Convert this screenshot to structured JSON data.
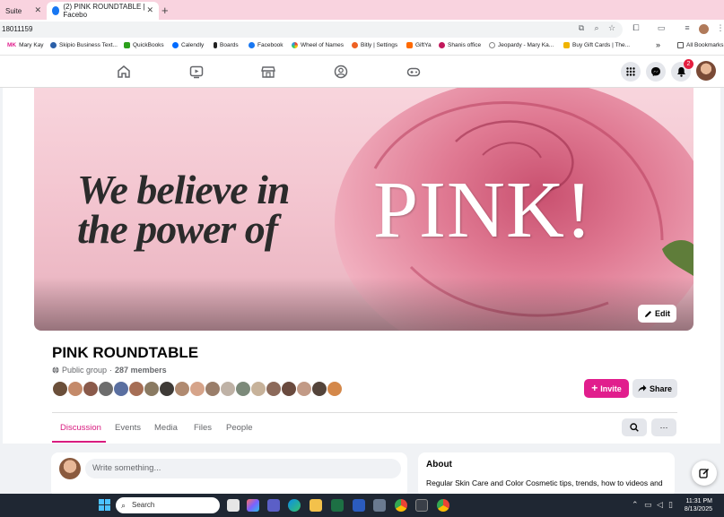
{
  "browser": {
    "tabs": [
      {
        "label": "Suite",
        "active": false
      },
      {
        "label": "(2) PINK ROUNDTABLE | Facebo",
        "active": true
      }
    ],
    "new_tab_glyph": "+",
    "close_glyph": "✕",
    "address": "18011159"
  },
  "bookmarks": [
    {
      "label": "Mary Kay",
      "color": "#e11e8d"
    },
    {
      "label": "Skipio Business Text...",
      "color": "#2b5fa8"
    },
    {
      "label": "QuickBooks",
      "color": "#2ca01c"
    },
    {
      "label": "Calendly",
      "color": "#006bff"
    },
    {
      "label": "Boards",
      "color": "#222222"
    },
    {
      "label": "Facebook",
      "color": "#1877f2"
    },
    {
      "label": "Wheel of Names",
      "color": "#e74c3c"
    },
    {
      "label": "Bitly | Settings",
      "color": "#ee6123"
    },
    {
      "label": "GiftYa",
      "color": "#ff6a00"
    },
    {
      "label": "Shanis office",
      "color": "#c2185b"
    },
    {
      "label": "Jeopardy - Mary Ka...",
      "color": "#888888"
    },
    {
      "label": "Buy Gift Cards | The...",
      "color": "#f0b400"
    },
    {
      "label": "»",
      "color": ""
    },
    {
      "label": "All Bookmarks",
      "color": "#555555"
    }
  ],
  "fb_nav": {
    "icons": [
      "home-icon",
      "watch-icon",
      "marketplace-icon",
      "groups-icon",
      "gaming-icon"
    ],
    "notification_count": "2"
  },
  "group": {
    "cover_tagline_line1": "We believe in",
    "cover_tagline_line2": "the power of",
    "cover_highlight": "PINK!",
    "edit_label": "Edit",
    "name": "PINK ROUNDTABLE",
    "privacy": "Public group",
    "separator": "·",
    "members": "287 members",
    "invite_label": "Invite",
    "share_label": "Share",
    "tabs": [
      "Discussion",
      "Events",
      "Media",
      "Files",
      "People"
    ],
    "more_glyph": "···"
  },
  "composer": {
    "placeholder": "Write something..."
  },
  "about": {
    "title": "About",
    "text": "Regular Skin Care and Color Cosmetic tips, trends, how to videos and"
  },
  "taskbar": {
    "search_label": "Search",
    "time": "11:31 PM",
    "date": "8/13/2025"
  },
  "colors": {
    "accent": "#e11e8d",
    "fb_blue": "#1877f2",
    "tab_strip": "#f9d3df"
  }
}
